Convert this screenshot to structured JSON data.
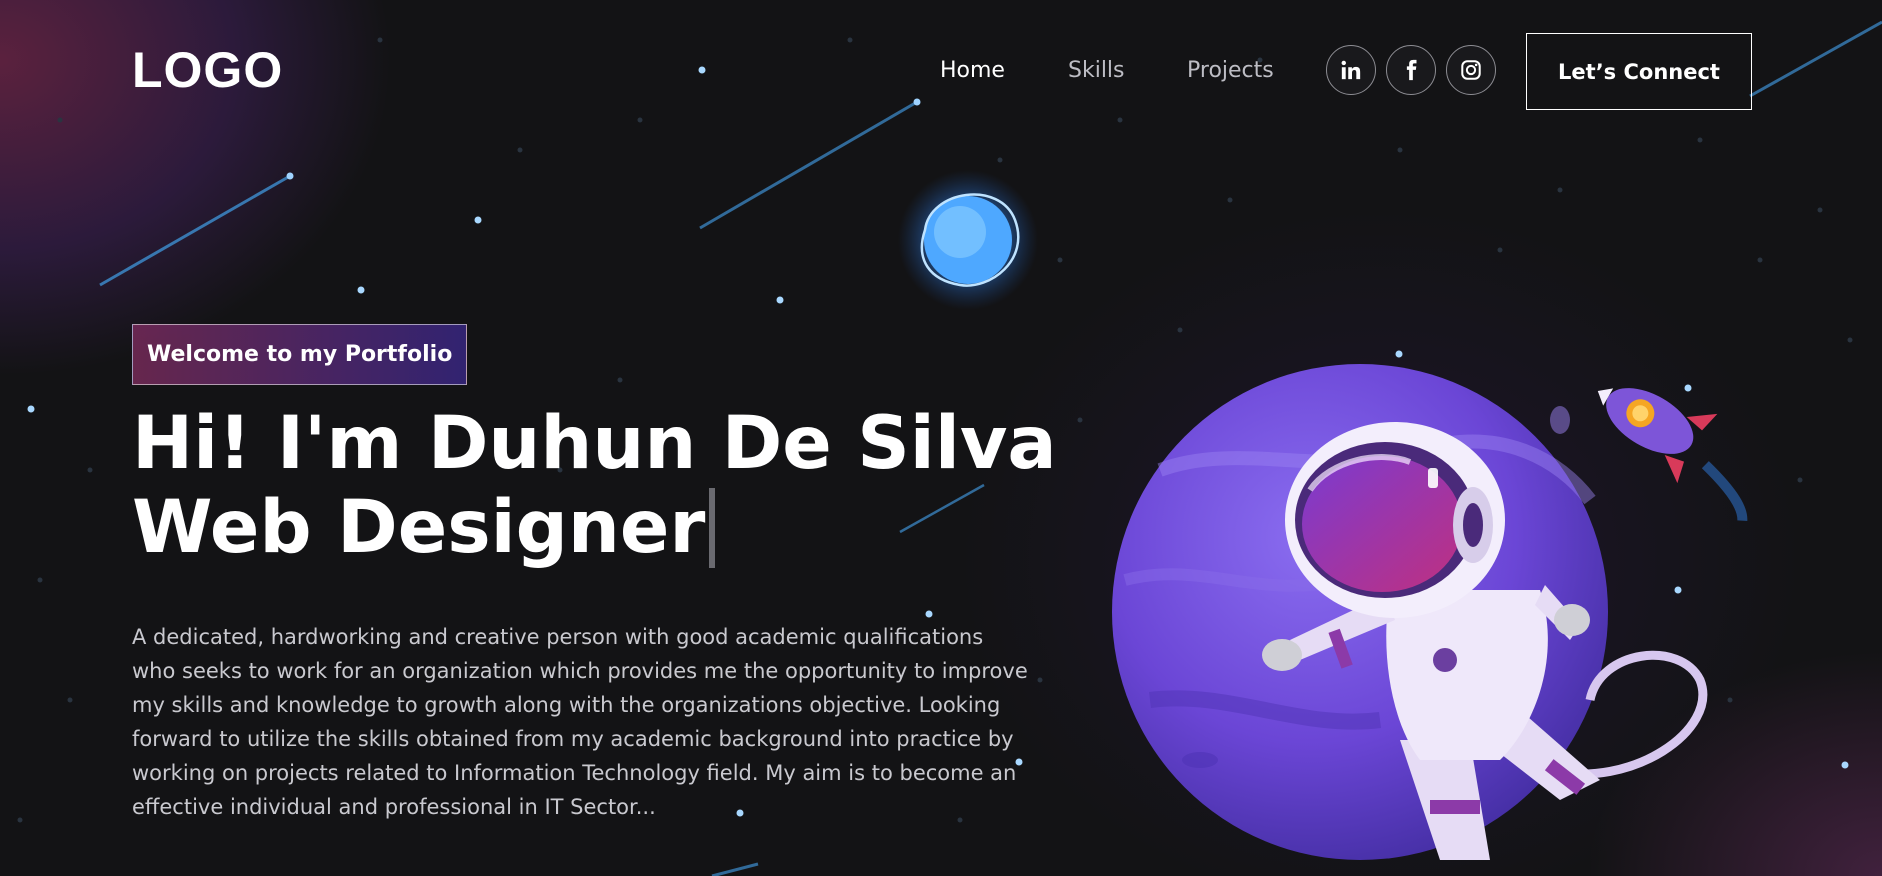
{
  "nav": {
    "logo": "LOGO",
    "links": [
      {
        "label": "Home",
        "active": true
      },
      {
        "label": "Skills",
        "active": false
      },
      {
        "label": "Projects",
        "active": false
      }
    ],
    "social": [
      "linkedin-icon",
      "facebook-icon",
      "instagram-icon"
    ],
    "cta": "Let’s Connect"
  },
  "hero": {
    "tagline": "Welcome to my Portfolio",
    "headline_line1": "Hi! I'm Duhun De Silva",
    "headline_line2": "Web Designer",
    "intro": "A dedicated, hardworking and creative person with good academic qualifications who seeks to work for an organization which provides me the opportunity to improve my skills and knowledge to growth along with the organizations objective. Looking forward to utilize the skills obtained from my academic background into practice by working on projects related to Information Technology field. My aim is to become an effective individual and professional in IT Sector..."
  },
  "colors": {
    "background": "#131315",
    "tagline_gradient_start": "#aa367c",
    "tagline_gradient_end": "#4a2fbd",
    "planet": "#6b46d6",
    "glow_orb": "#4ea8ff"
  }
}
